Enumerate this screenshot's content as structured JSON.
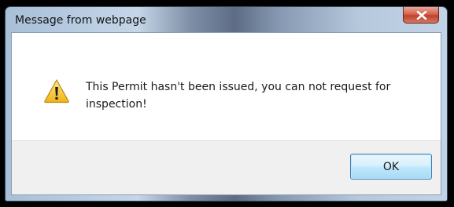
{
  "dialog": {
    "title": "Message from webpage",
    "message": "This Permit hasn't been issued, you can not request for inspection!",
    "ok_label": "OK",
    "icon": "warning-icon",
    "close_icon": "close-icon"
  },
  "colors": {
    "close_button": "#c7432d",
    "ok_button_border": "#3c7fb1",
    "footer_background": "#f0f0f0",
    "warning_fill": "#f7c52f"
  }
}
